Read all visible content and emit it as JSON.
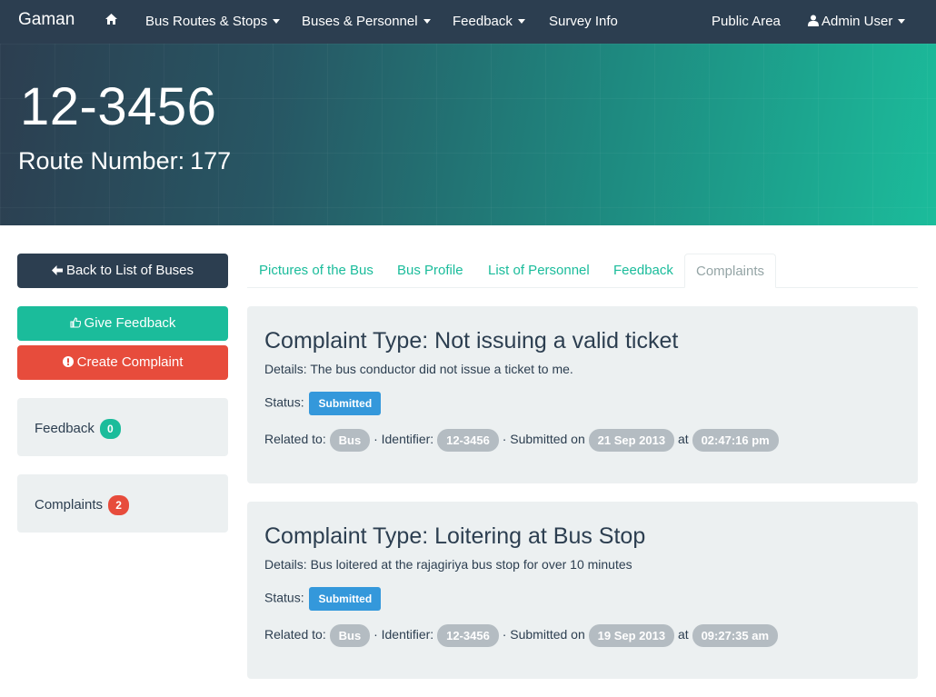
{
  "navbar": {
    "brand": "Gaman",
    "home_icon": "home-icon",
    "items": [
      {
        "label": "Bus Routes & Stops",
        "dropdown": true
      },
      {
        "label": "Buses & Personnel",
        "dropdown": true
      },
      {
        "label": "Feedback",
        "dropdown": true
      },
      {
        "label": "Survey Info",
        "dropdown": false
      }
    ],
    "public_area": "Public Area",
    "user": {
      "icon": "user-icon",
      "label": "Admin User",
      "dropdown": true
    }
  },
  "hero": {
    "plate": "12-3456",
    "route_label": "Route Number:",
    "route_number": "177"
  },
  "sidebar": {
    "back_button": {
      "icon": "arrow-left-icon",
      "label": "Back to List of Buses"
    },
    "feedback_button": {
      "icon": "thumbs-up-icon",
      "label": "Give Feedback"
    },
    "complaint_button": {
      "icon": "exclamation-circle-icon",
      "label": "Create Complaint"
    },
    "feedback_count": {
      "label": "Feedback",
      "count": "0"
    },
    "complaints_count": {
      "label": "Complaints",
      "count": "2"
    }
  },
  "tabs": [
    {
      "label": "Pictures of the Bus",
      "active": false
    },
    {
      "label": "Bus Profile",
      "active": false
    },
    {
      "label": "List of Personnel",
      "active": false
    },
    {
      "label": "Feedback",
      "active": false
    },
    {
      "label": "Complaints",
      "active": true
    }
  ],
  "complaints": [
    {
      "title": "Complaint Type: Not issuing a valid ticket",
      "details": "Details: The bus conductor did not issue a ticket to me.",
      "status_label": "Status:",
      "status": "Submitted",
      "related_label": "Related to:",
      "related": "Bus",
      "identifier_label": "· Identifier:",
      "identifier": "12-3456",
      "submitted_label": "· Submitted on",
      "date": "21 Sep 2013",
      "at_label": "at",
      "time": "02:47:16 pm"
    },
    {
      "title": "Complaint Type: Loitering at Bus Stop",
      "details": "Details: Bus loitered at the rajagiriya bus stop for over 10 minutes",
      "status_label": "Status:",
      "status": "Submitted",
      "related_label": "Related to:",
      "related": "Bus",
      "identifier_label": "· Identifier:",
      "identifier": "12-3456",
      "submitted_label": "· Submitted on",
      "date": "19 Sep 2013",
      "at_label": "at",
      "time": "09:27:35 am"
    }
  ],
  "colors": {
    "navbar": "#2c3e50",
    "accent": "#1bbc9b",
    "danger": "#e74c3c",
    "info": "#3498db",
    "well": "#ecf0f1",
    "pill": "#b4bcc2"
  }
}
